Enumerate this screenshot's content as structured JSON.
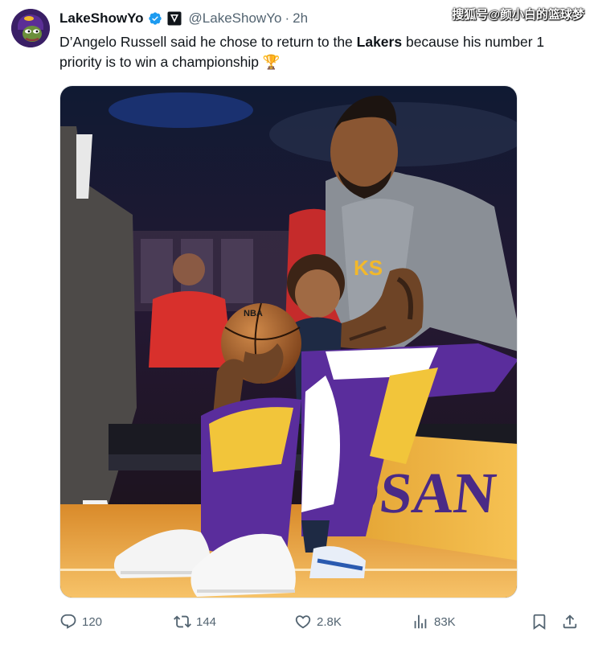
{
  "tweet": {
    "display_name": "LakeShowYo",
    "handle": "@LakeShowYo",
    "separator": "·",
    "time": "2h",
    "text_before": "D’Angelo Russell said he chose to return to the ",
    "text_bold": "Lakers",
    "text_after": " because his number 1 priority is to win a championship",
    "emoji": "🏆"
  },
  "watermark": "搜狐号@颜小白的篮球梦",
  "media": {
    "alt": "Player in Lakers warm-up shirt sitting courtside holding a basketball with a toddler in his lap",
    "court_text": "OSAN"
  },
  "actions": {
    "replies": "120",
    "reposts": "144",
    "likes": "2.8K",
    "views": "83K"
  },
  "icons": {
    "verified": "verified-badge-icon",
    "affiliation": "affiliation-icon",
    "reply": "reply-icon",
    "repost": "repost-icon",
    "like": "heart-icon",
    "views": "views-icon",
    "bookmark": "bookmark-icon",
    "share": "share-icon"
  },
  "colors": {
    "verified_blue": "#1d9bf0",
    "secondary_text": "#536471",
    "primary_text": "#0f1419",
    "lakers_purple": "#5a2d9c",
    "lakers_gold": "#f2b82b"
  }
}
